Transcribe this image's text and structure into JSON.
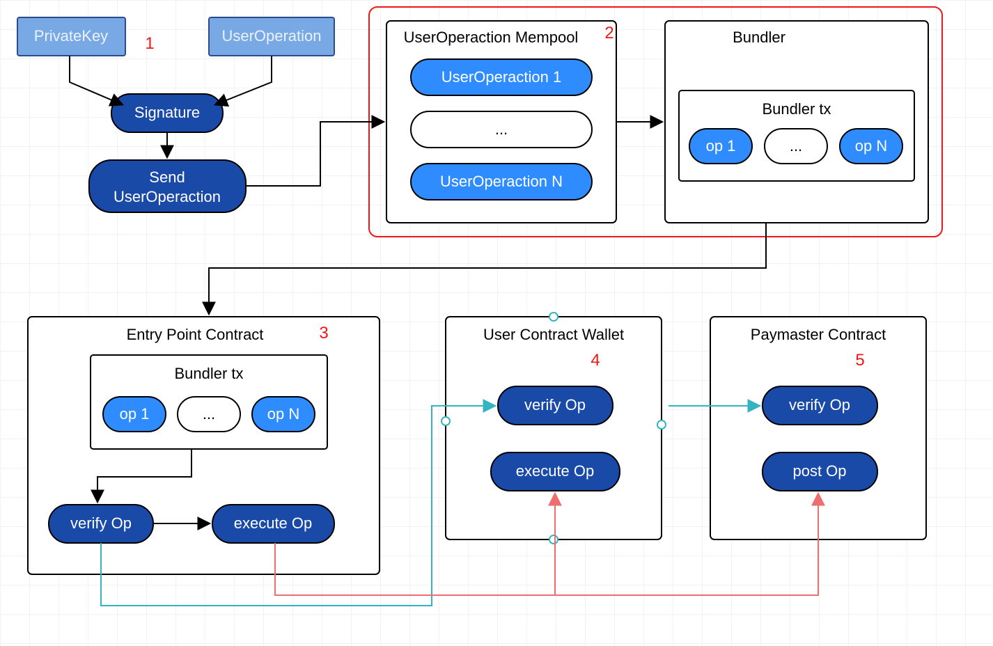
{
  "colors": {
    "darkBlue": "#1a4aa8",
    "midBlue": "#2e8cff",
    "lightBlue": "#79a9e5",
    "red": "#f01616",
    "teal": "#36b3c1",
    "lineRed": "#ec6e6e"
  },
  "step_labels": {
    "one": "1",
    "two": "2",
    "three": "3",
    "four": "4",
    "five": "5"
  },
  "top": {
    "private_key": "PrivateKey",
    "user_op": "UserOperation",
    "signature": "Signature",
    "send_line1": "Send",
    "send_line2": "UserOperaction"
  },
  "mempool": {
    "title": "UserOperaction Mempool",
    "op_first": "UserOperaction 1",
    "op_dots": "...",
    "op_last": "UserOperaction N"
  },
  "bundler": {
    "title": "Bundler",
    "tx_title": "Bundler tx",
    "op_first": "op 1",
    "op_dots": "...",
    "op_last": "op N"
  },
  "entry": {
    "title": "Entry Point Contract",
    "tx_title": "Bundler tx",
    "op_first": "op 1",
    "op_dots": "...",
    "op_last": "op N",
    "verify": "verify Op",
    "execute": "execute Op"
  },
  "wallet": {
    "title": "User Contract Wallet",
    "verify": "verify Op",
    "execute": "execute Op"
  },
  "paymaster": {
    "title": "Paymaster Contract",
    "verify": "verify Op",
    "post": "post Op"
  }
}
